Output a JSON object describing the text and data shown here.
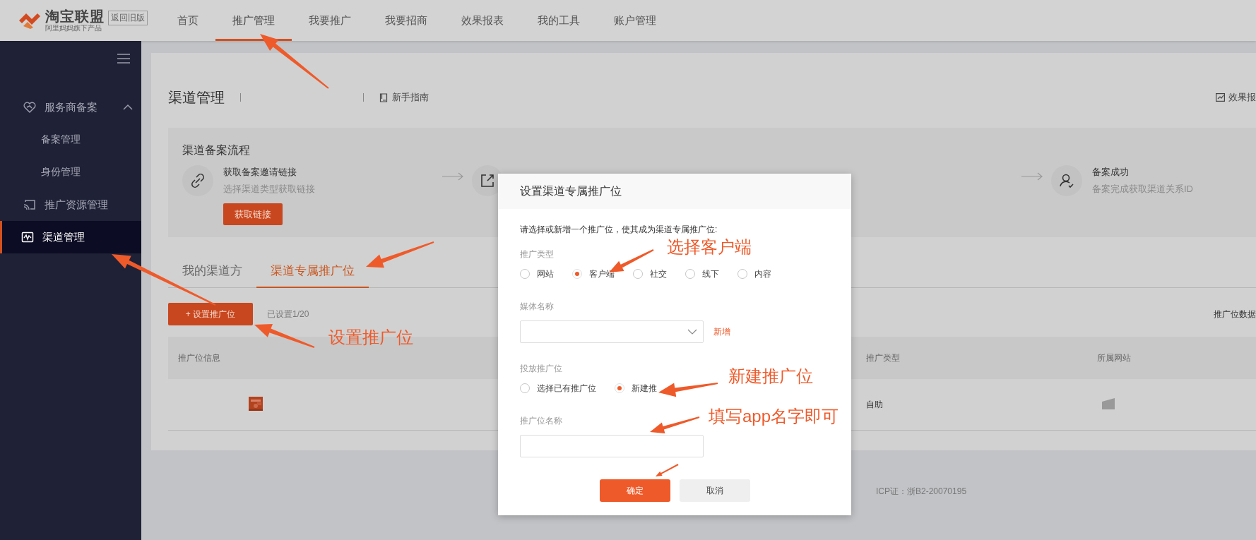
{
  "header": {
    "logo": {
      "title": "淘宝联盟",
      "subtitle": "阿里妈妈旗下产品"
    },
    "old_version": "返回旧版",
    "nav": [
      {
        "label": "首页",
        "selected": false
      },
      {
        "label": "推广管理",
        "selected": true
      },
      {
        "label": "我要推广",
        "selected": false
      },
      {
        "label": "我要招商",
        "selected": false
      },
      {
        "label": "效果报表",
        "selected": false
      },
      {
        "label": "我的工具",
        "selected": false
      },
      {
        "label": "账户管理",
        "selected": false
      }
    ]
  },
  "sidebar": {
    "items": [
      {
        "label": "服务商备案",
        "selected": false,
        "expanded": true,
        "children": [
          {
            "label": "备案管理",
            "selected": false
          },
          {
            "label": "身份管理",
            "selected": false
          }
        ]
      },
      {
        "label": "推广资源管理",
        "selected": false
      },
      {
        "label": "渠道管理",
        "selected": true
      }
    ]
  },
  "page": {
    "title": "渠道管理",
    "guide": "新手指南",
    "report_link": "效果报",
    "process": {
      "title": "渠道备案流程",
      "steps": [
        {
          "title": "获取备案邀请链接",
          "subtitle": "选择渠道类型获取链接",
          "button": "获取链接"
        },
        {
          "title": "备案成功",
          "subtitle": "备案完成获取渠道关系ID"
        }
      ]
    },
    "tabs": [
      {
        "label": "我的渠道方",
        "selected": false
      },
      {
        "label": "渠道专属推广位",
        "selected": true
      }
    ],
    "add_button": "+ 设置推广位",
    "count": "已设置1/20",
    "data_label": "推广位数据",
    "table": {
      "columns": [
        "推广位信息",
        "推广类型",
        "所属网站"
      ],
      "rows": [
        {
          "type": "自助"
        }
      ]
    }
  },
  "footer": {
    "icp": "ICP证：浙B2-20070195"
  },
  "dialog": {
    "title": "设置渠道专属推广位",
    "intro": "请选择或新增一个推广位，使其成为渠道专属推广位:",
    "sections": [
      {
        "kind": "radio",
        "label": "推广类型",
        "options": [
          {
            "label": "网站",
            "selected": false
          },
          {
            "label": "客户端",
            "selected": true
          },
          {
            "label": "社交",
            "selected": false
          },
          {
            "label": "线下",
            "selected": false
          },
          {
            "label": "内容",
            "selected": false
          }
        ]
      },
      {
        "kind": "select",
        "label": "媒体名称",
        "action": "新增"
      },
      {
        "kind": "radio",
        "label": "投放推广位",
        "options": [
          {
            "label": "选择已有推广位",
            "selected": false
          },
          {
            "label": "新建推",
            "selected": true
          }
        ]
      },
      {
        "kind": "input",
        "label": "推广位名称"
      }
    ],
    "buttons": [
      {
        "label": "确定",
        "kind": "primary"
      },
      {
        "label": "取消",
        "kind": "secondary"
      }
    ]
  },
  "annotations": [
    {
      "text": "选择客户端"
    },
    {
      "text": "设置推广位"
    },
    {
      "text": "新建推广位"
    },
    {
      "text": "填写app名字即可"
    }
  ]
}
